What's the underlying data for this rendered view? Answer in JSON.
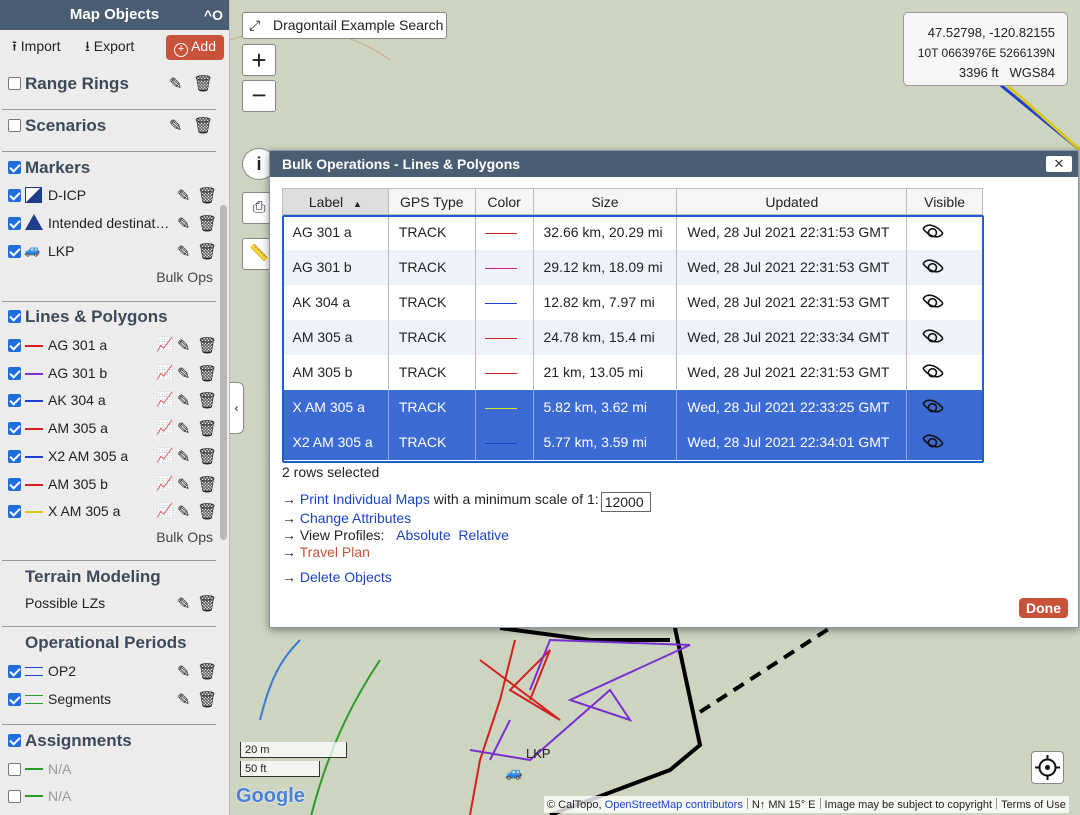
{
  "sidebar": {
    "title": "Map Objects",
    "collapse_icon": "^O",
    "toolbar": {
      "import": "Import",
      "export": "Export",
      "add": "Add"
    },
    "sections": {
      "range_rings": "Range Rings",
      "scenarios": "Scenarios",
      "markers": {
        "title": "Markers",
        "items": [
          "D-ICP",
          "Intended destinat…",
          "LKP"
        ],
        "bulk_ops": "Bulk Ops"
      },
      "lines": {
        "title": "Lines & Polygons",
        "items": [
          {
            "label": "AG 301 a",
            "color": "#d42020"
          },
          {
            "label": "AG 301 b",
            "color": "#7a2fd0"
          },
          {
            "label": "AK 304 a",
            "color": "#1c3fd0"
          },
          {
            "label": "AM 305 a",
            "color": "#d42020"
          },
          {
            "label": "X2 AM 305 a",
            "color": "#1c3fd0"
          },
          {
            "label": "AM 305 b",
            "color": "#d42020"
          },
          {
            "label": "X AM 305 a",
            "color": "#d8c61a"
          }
        ],
        "bulk_ops": "Bulk Ops"
      },
      "terrain": {
        "title": "Terrain Modeling",
        "item": "Possible LZs"
      },
      "op_periods": {
        "title": "Operational Periods",
        "items": [
          "OP2",
          "Segments"
        ]
      },
      "assignments": {
        "title": "Assignments",
        "items": [
          "N/A",
          "N/A"
        ]
      }
    }
  },
  "map": {
    "search_button": "Dragontail Example Search",
    "zoom_in": "+",
    "zoom_out": "−",
    "coords": {
      "latlon": "47.52798, -120.82155",
      "utm": "10T 0663976E 5266139N",
      "elev": "3396 ft",
      "datum": "WGS84"
    },
    "scale_m": "20 m",
    "scale_ft": "50 ft",
    "google": "Google",
    "lkp_label": "LKP",
    "attribution": {
      "caltopo": "© CalTopo,",
      "osm": "OpenStreetMap contributors",
      "north": "N↑ MN 15° E",
      "copyright": "Image may be subject to copyright",
      "terms": "Terms of Use"
    }
  },
  "dialog": {
    "title": "Bulk Operations - Lines & Polygons",
    "close": "✕",
    "columns": [
      "Label",
      "GPS Type",
      "Color",
      "Size",
      "Updated",
      "Visible"
    ],
    "rows": [
      {
        "label": "AG 301 a",
        "gps": "TRACK",
        "color": "#d42020",
        "size": "32.66 km, 20.29 mi",
        "updated": "Wed, 28 Jul 2021 22:31:53 GMT"
      },
      {
        "label": "AG 301 b",
        "gps": "TRACK",
        "color": "#d42080",
        "size": "29.12 km, 18.09 mi",
        "updated": "Wed, 28 Jul 2021 22:31:53 GMT"
      },
      {
        "label": "AK 304 a",
        "gps": "TRACK",
        "color": "#1c3fd0",
        "size": "12.82 km, 7.97 mi",
        "updated": "Wed, 28 Jul 2021 22:31:53 GMT"
      },
      {
        "label": "AM 305 a",
        "gps": "TRACK",
        "color": "#d42020",
        "size": "24.78 km, 15.4 mi",
        "updated": "Wed, 28 Jul 2021 22:33:34 GMT"
      },
      {
        "label": "AM 305 b",
        "gps": "TRACK",
        "color": "#d42020",
        "size": "21 km, 13.05 mi",
        "updated": "Wed, 28 Jul 2021 22:31:53 GMT"
      },
      {
        "label": "X AM 305 a",
        "gps": "TRACK",
        "color": "#d8e020",
        "size": "5.82 km, 3.62 mi",
        "updated": "Wed, 28 Jul 2021 22:33:25 GMT"
      },
      {
        "label": "X2 AM 305 a",
        "gps": "TRACK",
        "color": "#1c3fd0",
        "size": "5.77 km, 3.59 mi",
        "updated": "Wed, 28 Jul 2021 22:34:01 GMT"
      }
    ],
    "rows_selected": "2 rows selected",
    "actions": {
      "print_link": "Print Individual Maps",
      "print_text": " with a minimum scale of 1:",
      "scale_value": "12000",
      "change_attr": "Change Attributes",
      "view_profiles": "View Profiles:",
      "absolute": "Absolute",
      "relative": "Relative",
      "travel_plan": "Travel Plan",
      "delete": "Delete Objects"
    },
    "done": "Done"
  }
}
